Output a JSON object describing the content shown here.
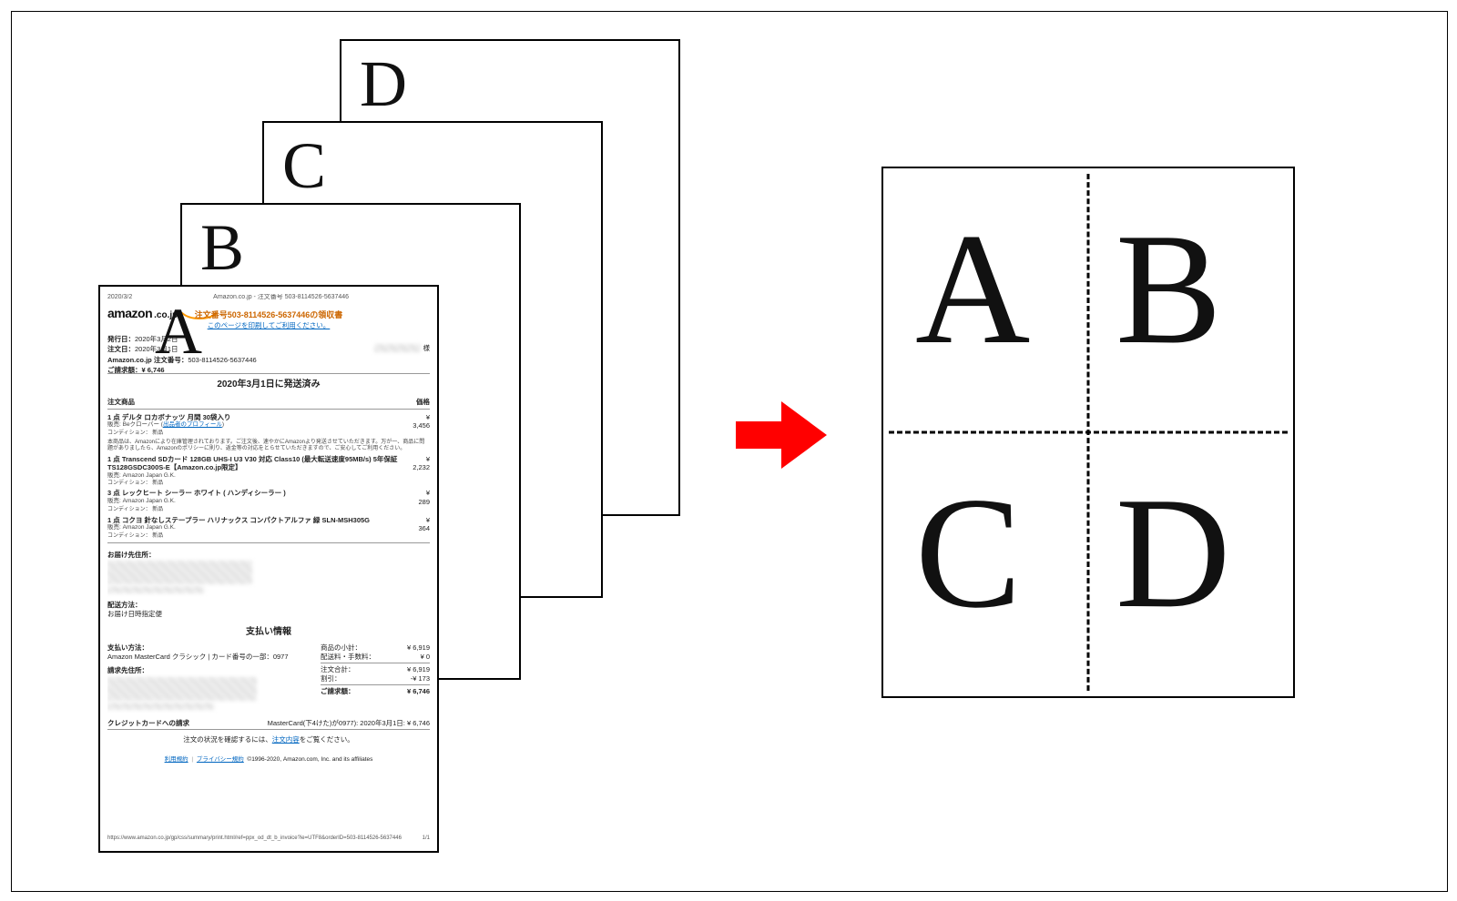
{
  "diagram": {
    "stack_labels": {
      "a": "A",
      "b": "B",
      "c": "C",
      "d": "D"
    },
    "quad_labels": {
      "a": "A",
      "b": "B",
      "c": "C",
      "d": "D"
    }
  },
  "receipt": {
    "topbar": {
      "date": "2020/3/2",
      "center": "Amazon.co.jp - 注文番号 503-8114526-5637446"
    },
    "logo": {
      "brand": "amazon",
      "suffix": ".co.jp"
    },
    "title": "注文番号503-8114526-5637446の領収書",
    "print_link": "このページを印刷してご利用ください。",
    "honorific": "様",
    "meta": {
      "issued_label": "発行日：",
      "issued_value": "2020年3月2日",
      "order_date_label": "注文日：",
      "order_date_value": "2020年3月1日",
      "order_no_label": "Amazon.co.jp 注文番号：",
      "order_no_value": "503-8114526-5637446",
      "billed_label": "ご請求額：",
      "billed_value": "¥ 6,746"
    },
    "shipped_heading": "2020年3月1日に発送済み",
    "columns": {
      "left": "注文商品",
      "right": "価格"
    },
    "items": [
      {
        "name": "1 点  デルタ ロカボナッツ 月間 30袋入り",
        "seller_prefix": "販売: Beクローバー (",
        "seller_link": "出品者のプロフィール",
        "seller_suffix": ")",
        "condition": "コンディション： 新品",
        "note": "本商品は、Amazonにより在庫管理されております。ご注文後、速やかにAmazonより発送させていただきます。万が一、商品に問題がありましたら、Amazonのポリシーに則り、返金等の対応をとらせていただきますので、ご安心してご利用ください。",
        "currency": "¥",
        "price": "3,456"
      },
      {
        "name": "1 点  Transcend SDカード 128GB UHS-I U3 V30 対応 Class10 (最大転送速度95MB/s) 5年保証 TS128GSDC300S-E【Amazon.co.jp限定】",
        "seller_plain": "販売: Amazon Japan G.K.",
        "condition": "コンディション： 新品",
        "currency": "¥",
        "price": "2,232"
      },
      {
        "name": "3 点  レックヒート シーラー ホワイト ( ハンディシーラー )",
        "seller_plain": "販売: Amazon Japan G.K.",
        "condition": "コンディション： 新品",
        "currency": "¥",
        "price": "289"
      },
      {
        "name": "1 点  コクヨ 針なしステープラー ハリナックス コンパクトアルファ 緑 SLN-MSH305G",
        "seller_plain": "販売: Amazon Japan G.K.",
        "condition": "コンディション： 新品",
        "currency": "¥",
        "price": "364"
      }
    ],
    "ship_to_label": "お届け先住所：",
    "ship_method_label": "配送方法：",
    "ship_method_value": "お届け日時指定便",
    "payment_heading": "支払い情報",
    "pay_method_label": "支払い方法：",
    "pay_method_value": "Amazon MasterCard クラシック | カード番号の一部：0977",
    "bill_to_label": "請求先住所：",
    "summary": {
      "subtotal_label": "商品の小計：",
      "subtotal_value": "¥ 6,919",
      "shipping_label": "配送料・手数料：",
      "shipping_value": "¥ 0",
      "order_total_label": "注文合計：",
      "order_total_value": "¥ 6,919",
      "discount_label": "割引：",
      "discount_value": "-¥ 173",
      "grand_label": "ご請求額：",
      "grand_value": "¥ 6,746"
    },
    "cc_label": "クレジットカードへの請求",
    "cc_value": "MasterCard(下4けた)が0977):  2020年3月1日:  ¥ 6,746",
    "confirm_prefix": "注文の状況を確認するには、",
    "confirm_link": "注文内容",
    "confirm_suffix": "をご覧ください。",
    "footer_links": {
      "terms": "利用規約",
      "privacy": "プライバシー規約",
      "copyright": "©1996-2020, Amazon.com, Inc. and its affiliates"
    },
    "footer_url": "https://www.amazon.co.jp/gp/css/summary/print.html/ref=ppx_od_dt_b_invoice?ie=UTF8&orderID=503-8114526-5637446",
    "page_no": "1/1"
  }
}
